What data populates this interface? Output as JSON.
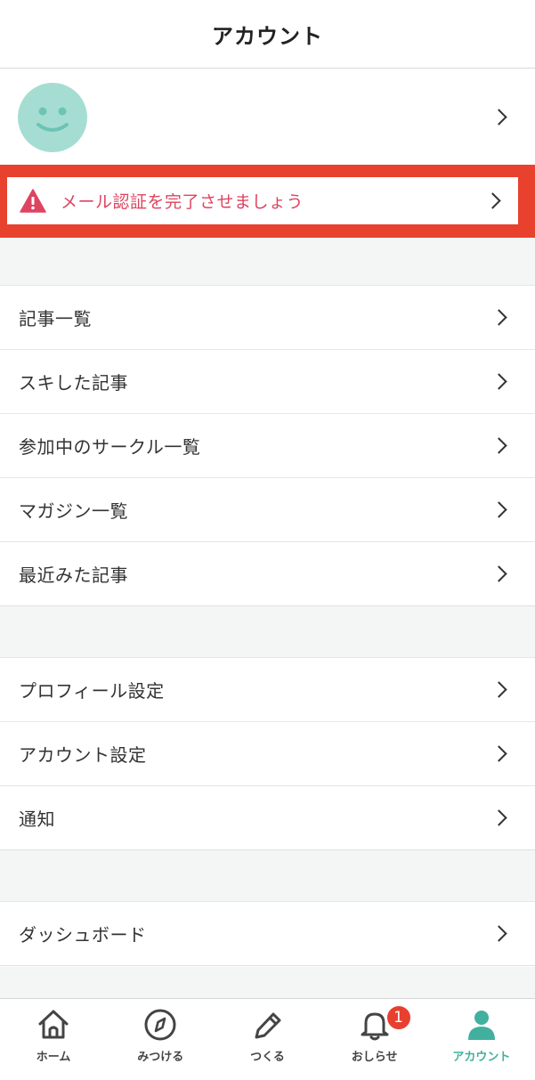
{
  "header": {
    "title": "アカウント"
  },
  "alert": {
    "text": "メール認証を完了させましょう",
    "color": "#dd4460",
    "frame_color": "#e8412d",
    "icon": "warning-icon"
  },
  "profile": {
    "avatar_color": "#a6ddd3",
    "icon": "smiley-avatar"
  },
  "section1": {
    "items": [
      {
        "label": "記事一覧"
      },
      {
        "label": "スキした記事"
      },
      {
        "label": "参加中のサークル一覧"
      },
      {
        "label": "マガジン一覧"
      },
      {
        "label": "最近みた記事"
      }
    ]
  },
  "section2": {
    "items": [
      {
        "label": "プロフィール設定"
      },
      {
        "label": "アカウント設定"
      },
      {
        "label": "通知"
      }
    ]
  },
  "section3": {
    "items": [
      {
        "label": "ダッシュボード"
      }
    ]
  },
  "tabbar": {
    "accent": "#41b09e",
    "tabs": [
      {
        "label": "ホーム",
        "icon": "home-icon"
      },
      {
        "label": "みつける",
        "icon": "compass-icon"
      },
      {
        "label": "つくる",
        "icon": "pencil-icon"
      },
      {
        "label": "おしらせ",
        "icon": "bell-icon",
        "badge": "1"
      },
      {
        "label": "アカウント",
        "icon": "person-icon",
        "active": true
      }
    ]
  }
}
